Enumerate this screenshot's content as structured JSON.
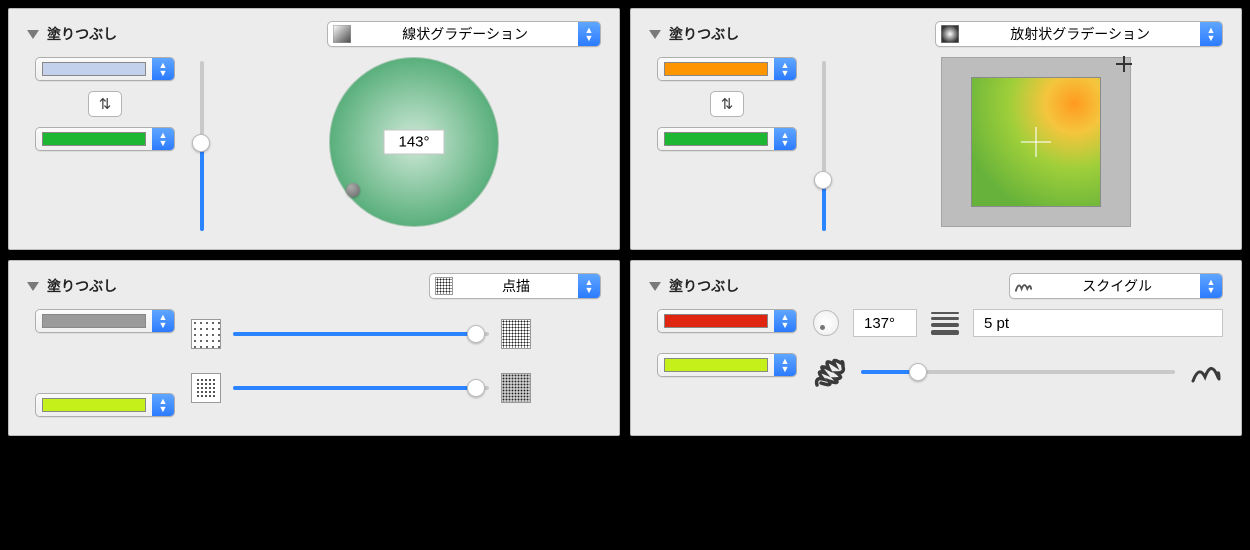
{
  "panels": {
    "linear": {
      "title": "塗りつぶし",
      "fillType": "線状グラデーション",
      "color1": "#c3d1ec",
      "color2": "#1eb733",
      "sliderPercent": 52,
      "angle": "143°",
      "handleAngleDeg": 233
    },
    "radial": {
      "title": "塗りつぶし",
      "fillType": "放射状グラデーション",
      "color1": "#ff9500",
      "color2": "#1eb733",
      "sliderPercent": 30
    },
    "stipple": {
      "title": "塗りつぶし",
      "fillType": "点描",
      "color1": "#9a9a9a",
      "color2": "#c6f01a",
      "slider1Percent": 95,
      "slider2Percent": 95
    },
    "squiggle": {
      "title": "塗りつぶし",
      "fillType": "スクイグル",
      "color1": "#e02610",
      "color2": "#c6f01a",
      "angle": "137°",
      "thickness": "5 pt",
      "sliderPercent": 18
    }
  }
}
